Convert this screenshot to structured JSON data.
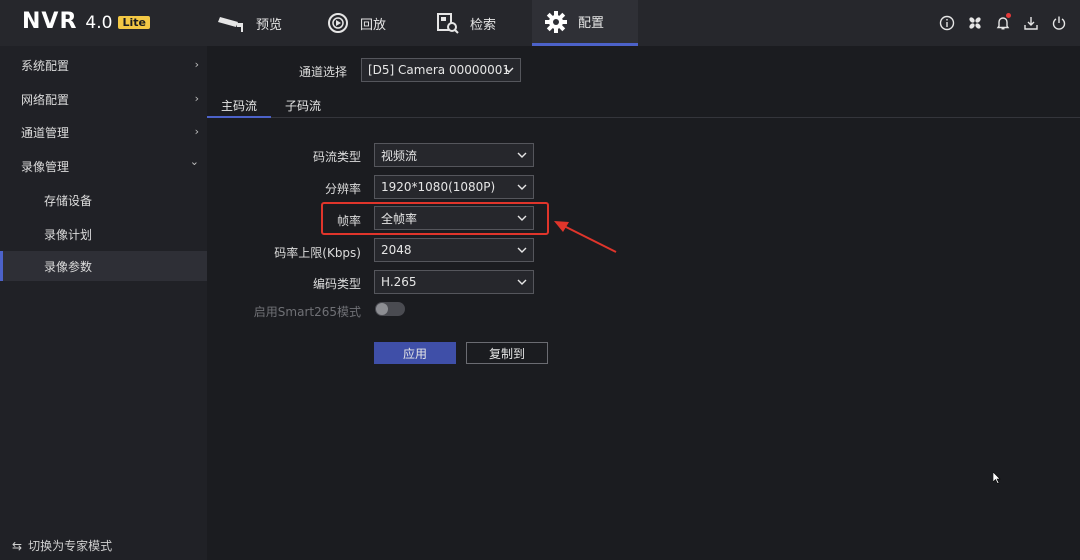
{
  "app": {
    "logo": "NVR",
    "version": "4.0",
    "edition": "Lite"
  },
  "nav": {
    "preview": "预览",
    "playback": "回放",
    "search": "检索",
    "config": "配置"
  },
  "top_icons": [
    "info-icon",
    "fan-icon",
    "bell-icon",
    "download-icon",
    "power-icon"
  ],
  "sidebar": {
    "items": [
      {
        "label": "系统配置",
        "chevron": "›"
      },
      {
        "label": "网络配置",
        "chevron": "›"
      },
      {
        "label": "通道管理",
        "chevron": "›"
      },
      {
        "label": "录像管理",
        "chevron": "⌄"
      }
    ],
    "sub_items": [
      {
        "label": "存储设备"
      },
      {
        "label": "录像计划"
      },
      {
        "label": "录像参数"
      }
    ],
    "expert_mode": "切换为专家模式",
    "expert_symbol": "⇆"
  },
  "main": {
    "channel_label": "通道选择",
    "channel_value": "[D5] Camera 00000001",
    "tabs": [
      "主码流",
      "子码流"
    ],
    "fields": {
      "stream_type": {
        "label": "码流类型",
        "value": "视频流"
      },
      "resolution": {
        "label": "分辨率",
        "value": "1920*1080(1080P)"
      },
      "frame_rate": {
        "label": "帧率",
        "value": "全帧率"
      },
      "bitrate_limit": {
        "label": "码率上限(Kbps)",
        "value": "2048"
      },
      "codec": {
        "label": "编码类型",
        "value": "H.265"
      },
      "smart265": {
        "label": "启用Smart265模式",
        "enabled": false
      }
    },
    "apply_button": "应用",
    "copy_button": "复制到"
  },
  "colors": {
    "accent": "#4c62c9",
    "highlight": "#e0352b",
    "bell_dot": "#e53a3a",
    "lite_badge": "#f3c845"
  }
}
